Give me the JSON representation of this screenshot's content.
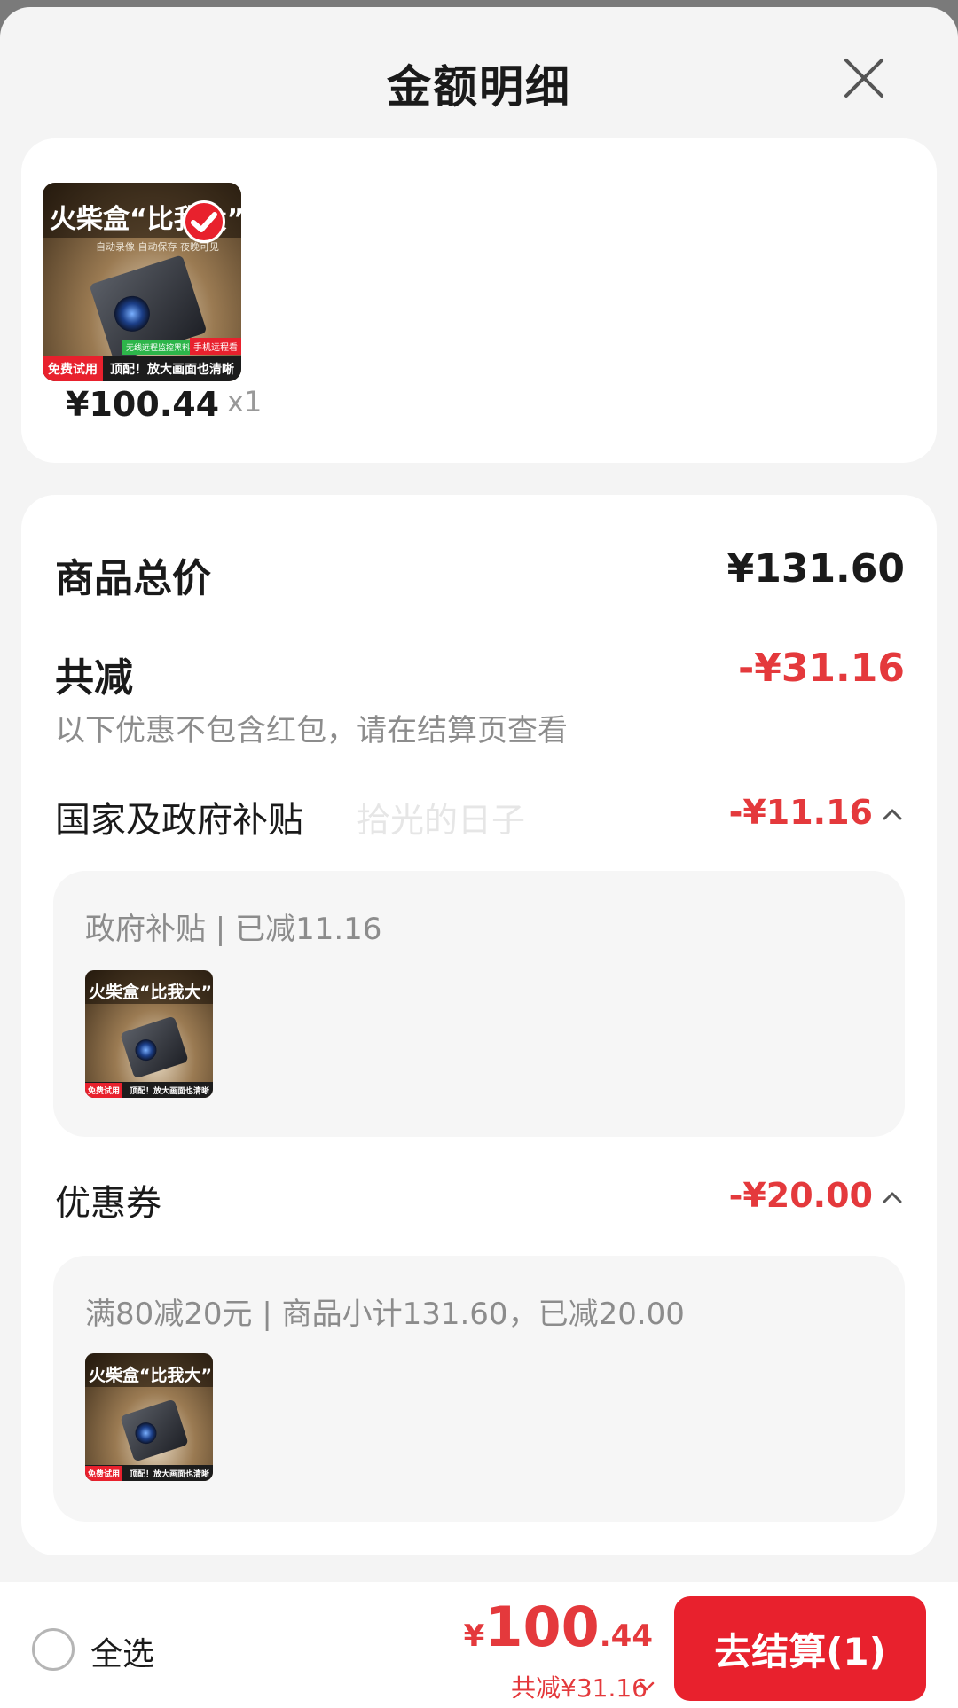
{
  "header": {
    "title": "金额明细"
  },
  "product": {
    "image": {
      "banner": "火柴盒“比我大”",
      "subtitle": "自动录像 自动保存 夜晚可见",
      "tag_left": "免费试用",
      "tag_mid": "无线远程监控黑科技",
      "tag_right": "手机远程看",
      "bottom_text": "顶配！放大画面也清晰"
    },
    "price": "¥100.44",
    "qty": "x1"
  },
  "summary": {
    "total_label": "商品总价",
    "total_value": "¥131.60",
    "discount_label": "共减",
    "discount_value": "-¥31.16",
    "hint": "以下优惠不包含红包，请在结算页查看"
  },
  "watermark": "拾光的日子",
  "subsidy": {
    "label": "国家及政府补贴",
    "value": "-¥11.16",
    "detail": "政府补贴 | 已减11.16"
  },
  "coupon": {
    "label": "优惠券",
    "value": "-¥20.00",
    "detail": "满80减20元 | 商品小计131.60，已减20.00"
  },
  "bottom": {
    "select_all": "全选",
    "currency": "¥",
    "total_int": "100",
    "total_dec": ".44",
    "saved": "共减¥31.16",
    "checkout": "去结算(1)"
  },
  "colors": {
    "accent": "#e8212d",
    "discount": "#e4393c",
    "sheet": "#f4f4f4"
  },
  "icons": [
    "close-icon",
    "check-icon",
    "chevron-up-icon",
    "chevron-down-icon"
  ]
}
